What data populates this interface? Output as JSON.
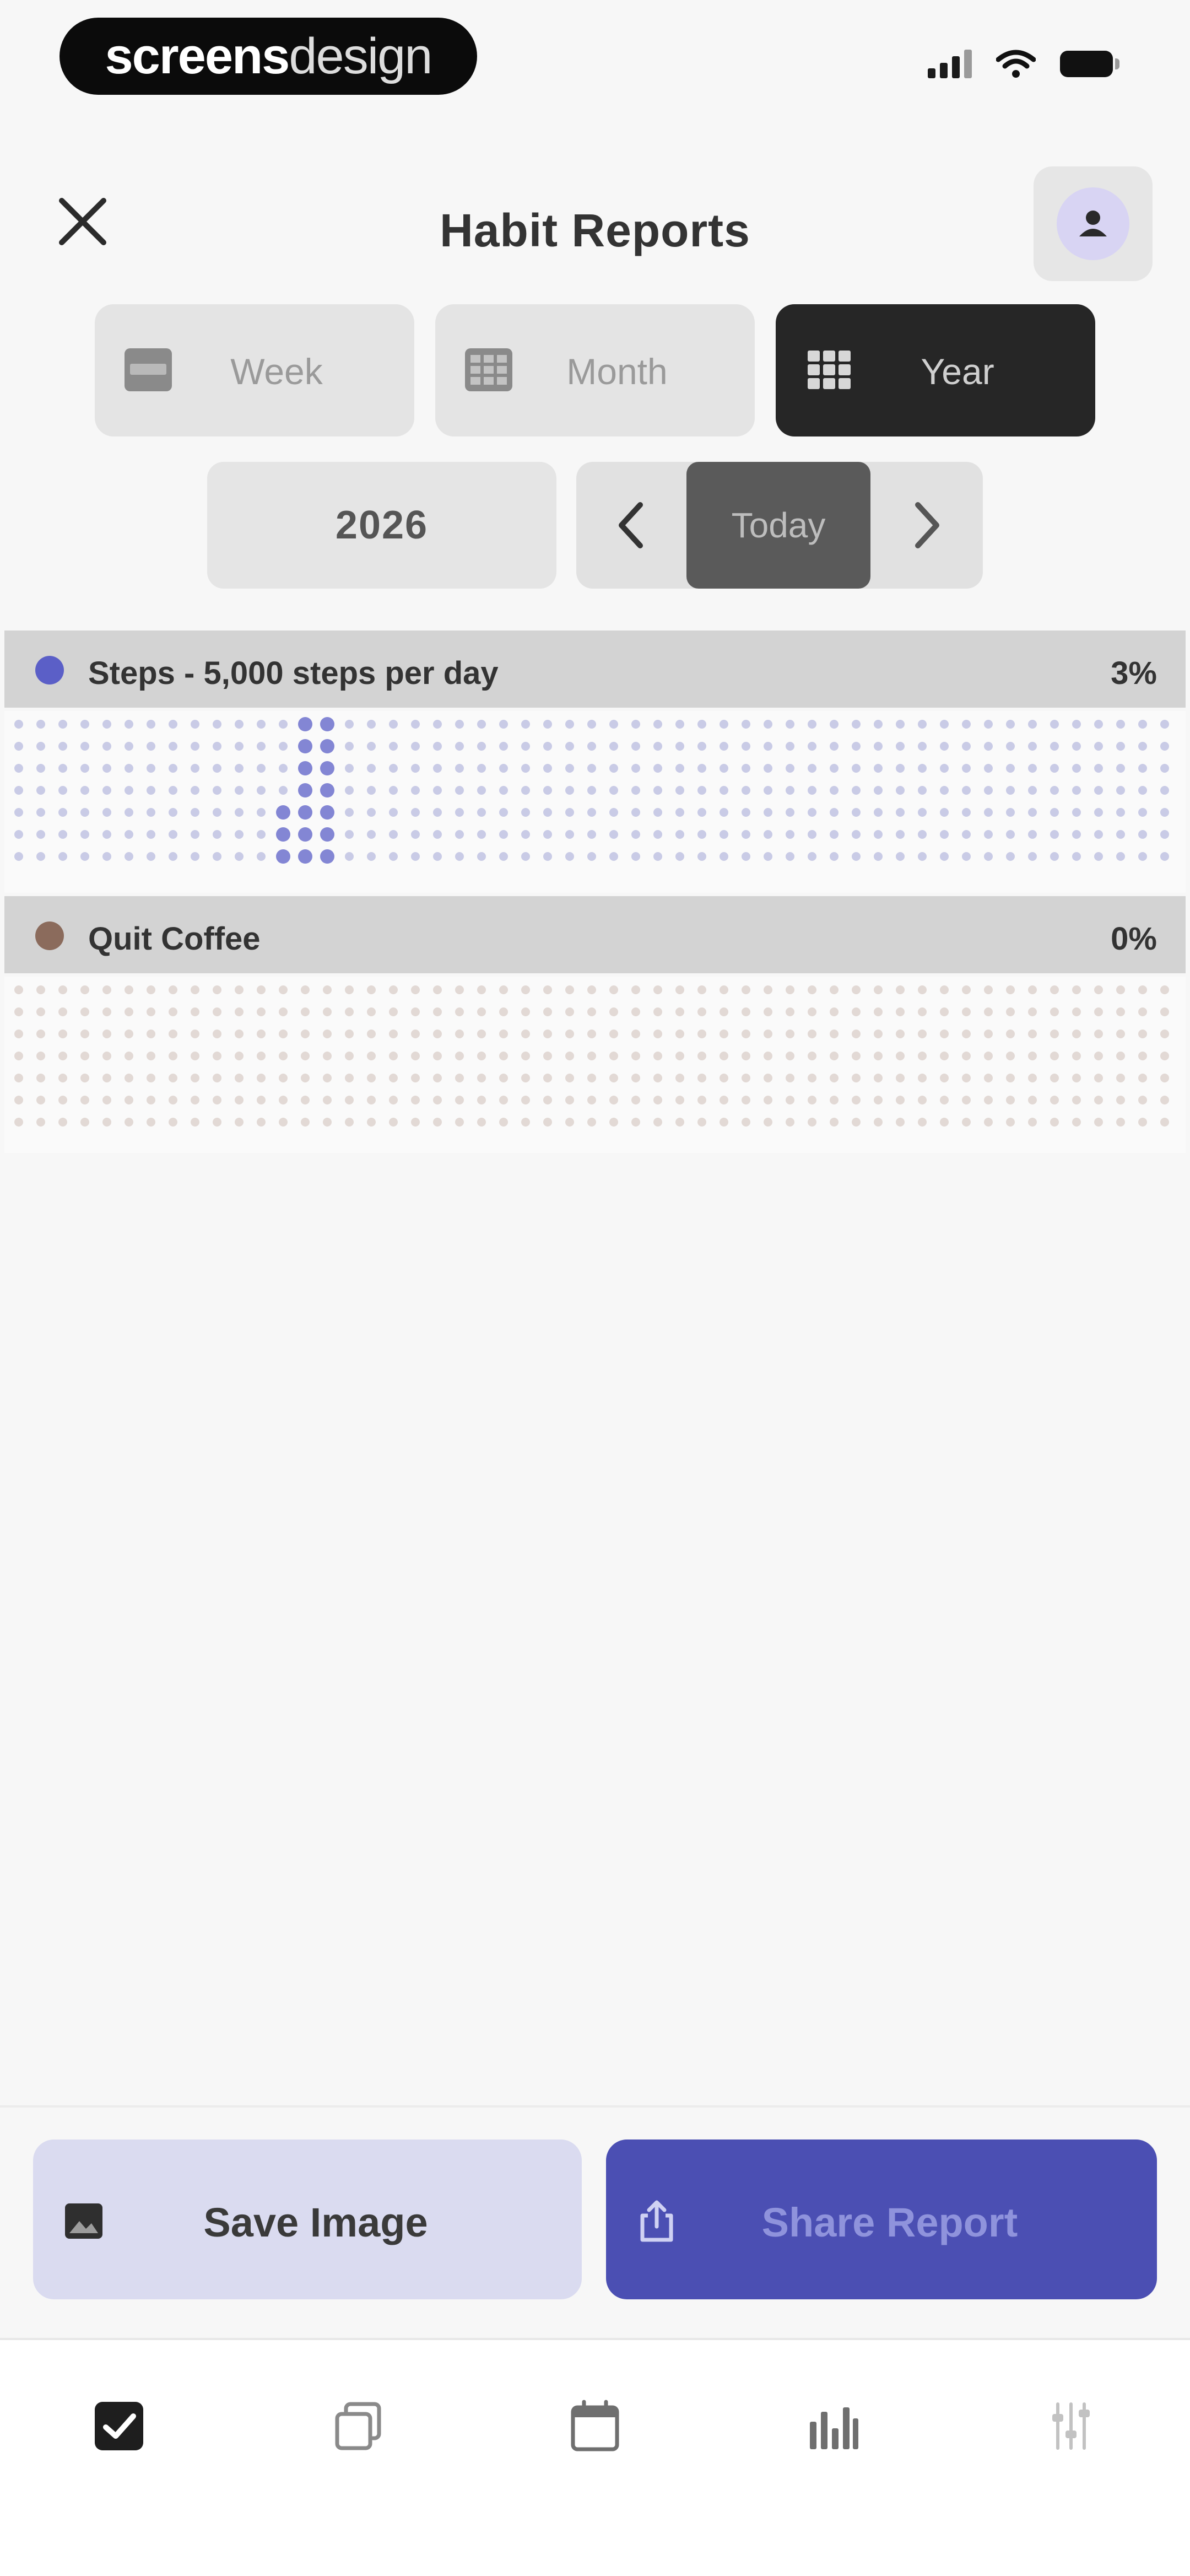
{
  "status_bar": {
    "brand_bold": "screens",
    "brand_light": "design",
    "icons": [
      "cellular-signal-icon",
      "wifi-icon",
      "battery-icon"
    ]
  },
  "header": {
    "title": "Habit Reports",
    "close_icon": "close-icon",
    "avatar_icon": "avatar-icon"
  },
  "segments": [
    {
      "label": "Week",
      "icon": "week-grid-icon",
      "active": false
    },
    {
      "label": "Month",
      "icon": "month-grid-icon",
      "active": false
    },
    {
      "label": "Year",
      "icon": "year-grid-icon",
      "active": true
    }
  ],
  "period": {
    "year": "2026",
    "today_label": "Today",
    "prev_icon": "chevron-left-icon",
    "next_icon": "chevron-right-icon"
  },
  "habits": [
    {
      "name": "Steps - 5,000 steps per day",
      "percent": "3%",
      "color": "#5b5fc7",
      "empty_dot_color": "#c9cbe6",
      "filled_days": [
        [
          13,
          0
        ],
        [
          14,
          0
        ],
        [
          13,
          1
        ],
        [
          14,
          1
        ],
        [
          13,
          2
        ],
        [
          14,
          2
        ],
        [
          13,
          3
        ],
        [
          14,
          3
        ],
        [
          12,
          4
        ],
        [
          13,
          4
        ],
        [
          14,
          4
        ],
        [
          12,
          5
        ],
        [
          13,
          5
        ],
        [
          14,
          5
        ],
        [
          12,
          6
        ],
        [
          13,
          6
        ],
        [
          14,
          6
        ],
        [
          12,
          7
        ],
        [
          13,
          7
        ]
      ],
      "highlight_day": [
        13,
        7
      ]
    },
    {
      "name": "Quit Coffee",
      "percent": "0%",
      "color": "#8b6b5c",
      "empty_dot_color": "#e2d9d5",
      "filled_days": [],
      "highlight_day": null
    }
  ],
  "actions": {
    "save_label": "Save Image",
    "share_label": "Share Report",
    "save_icon": "image-icon",
    "share_icon": "share-icon"
  },
  "tabbar": {
    "tabs": [
      "habits-checkbox-icon",
      "copy-stack-icon",
      "calendar-icon",
      "stats-icon",
      "settings-sliders-icon"
    ],
    "active_index": 0
  }
}
